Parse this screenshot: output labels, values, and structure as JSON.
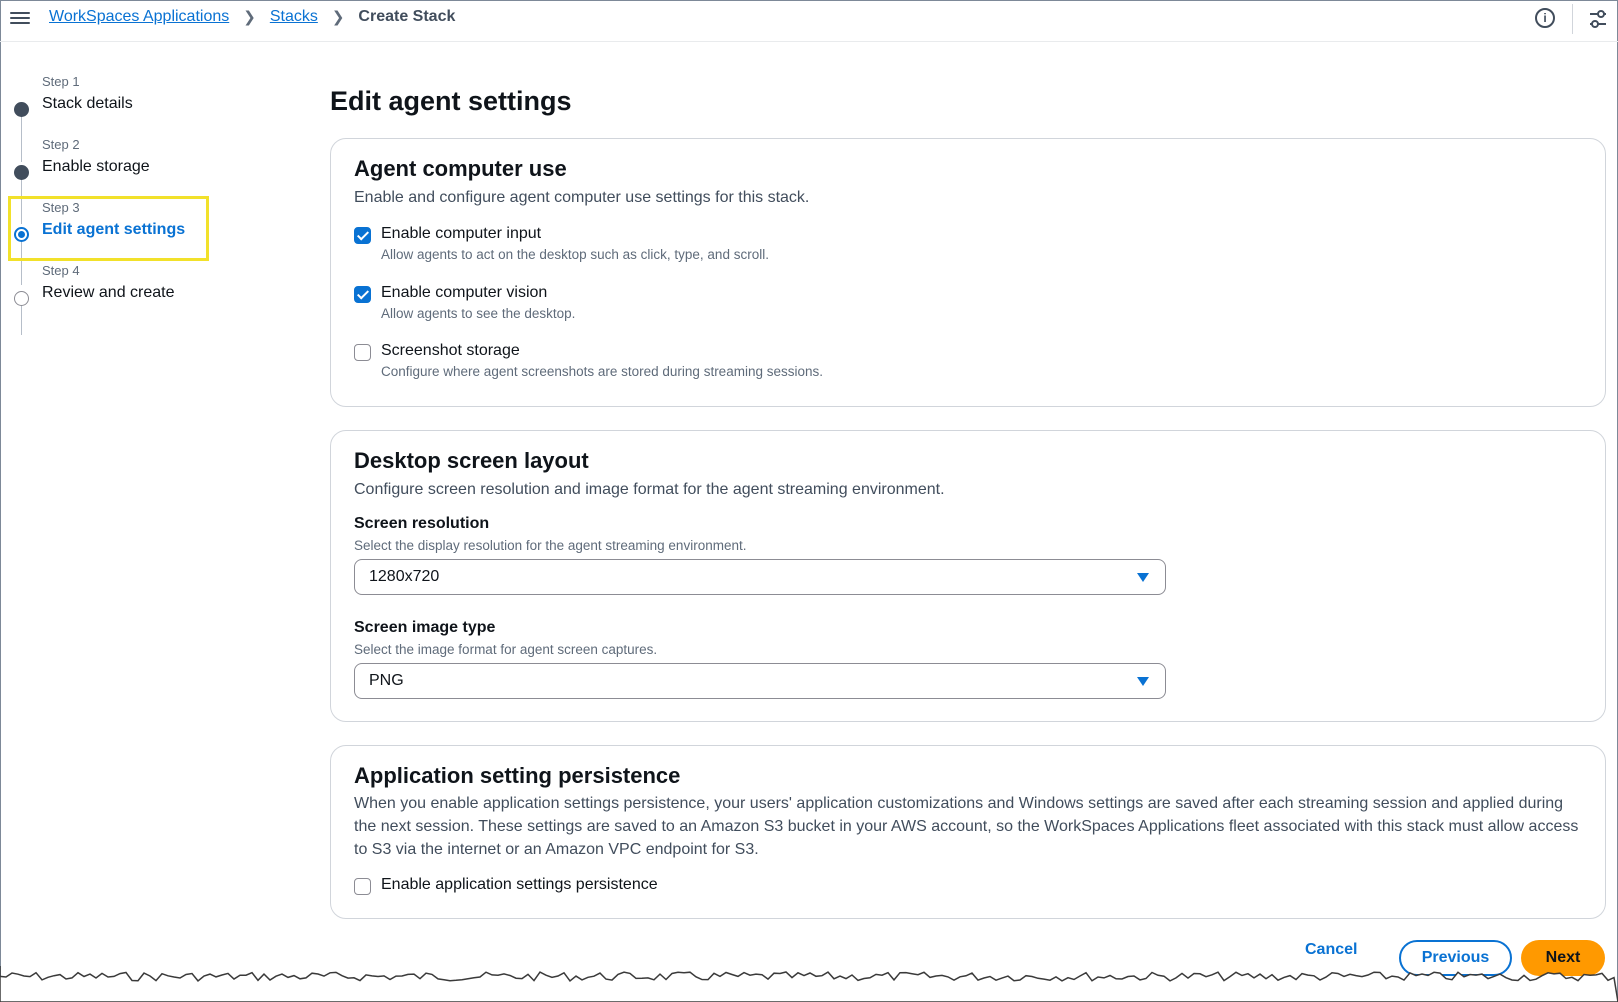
{
  "breadcrumbs": {
    "root": "WorkSpaces Applications",
    "stacks": "Stacks",
    "current": "Create Stack"
  },
  "steps": [
    {
      "num": "Step 1",
      "label": "Stack details",
      "state": "done"
    },
    {
      "num": "Step 2",
      "label": "Enable storage",
      "state": "done"
    },
    {
      "num": "Step 3",
      "label": "Edit agent settings",
      "state": "active"
    },
    {
      "num": "Step 4",
      "label": "Review and create",
      "state": "todo"
    }
  ],
  "page_title": "Edit agent settings",
  "agent_card": {
    "title": "Agent computer use",
    "description": "Enable and configure agent computer use settings for this stack.",
    "options": [
      {
        "label": "Enable computer input",
        "hint": "Allow agents to act on the desktop such as click, type, and scroll.",
        "checked": true
      },
      {
        "label": "Enable computer vision",
        "hint": "Allow agents to see the desktop.",
        "checked": true
      },
      {
        "label": "Screenshot storage",
        "hint": "Configure where agent screenshots are stored during streaming sessions.",
        "checked": false
      }
    ]
  },
  "layout_card": {
    "title": "Desktop screen layout",
    "description": "Configure screen resolution and image format for the agent streaming environment.",
    "resolution_label": "Screen resolution",
    "resolution_hint": "Select the display resolution for the agent streaming environment.",
    "resolution_value": "1280x720",
    "image_type_label": "Screen image type",
    "image_type_hint": "Select the image format for agent screen captures.",
    "image_type_value": "PNG"
  },
  "persistence_card": {
    "title": "Application setting persistence",
    "description_line1": "When you enable application settings persistence, your users' application customizations and Windows settings are saved after each streaming session and applied during",
    "description_line2": "the next session. These settings are saved to an Amazon S3 bucket in your AWS account, so the WorkSpaces Applications fleet associated with this stack must allow access",
    "description_line3": "to S3 via the internet or an Amazon VPC endpoint for S3.",
    "checkbox_label": "Enable application settings persistence",
    "checked": false
  },
  "footer": {
    "cancel": "Cancel",
    "previous": "Previous",
    "next": "Next"
  },
  "icons": {
    "menu": "hamburger-icon",
    "info": "info-icon",
    "settings": "settings-icon"
  },
  "colors": {
    "link": "#0972d3",
    "primary_button": "#ff9900",
    "highlight": "#f2e12a"
  },
  "info_glyph": "i"
}
